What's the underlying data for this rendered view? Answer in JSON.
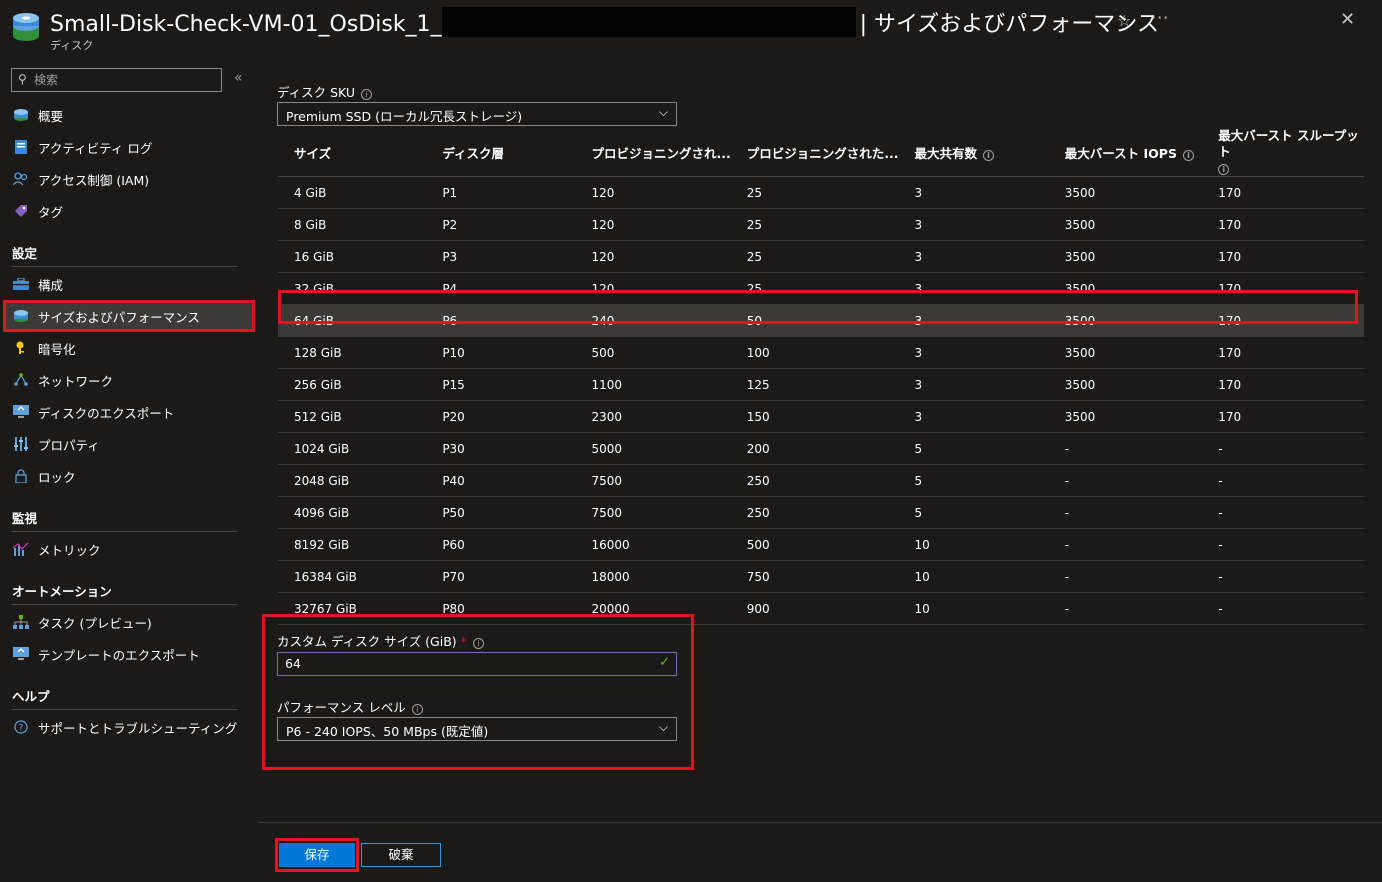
{
  "header": {
    "title_prefix": "Small-Disk-Check-VM-01_OsDisk_1_",
    "title_suffix": "| サイズおよびパフォーマンス",
    "subtitle": "ディスク",
    "star_glyph": "☆",
    "more_glyph": "···",
    "close_glyph": "✕"
  },
  "sidebar": {
    "search_placeholder": "検索",
    "collapse_glyph": "«",
    "items_top": [
      {
        "label": "概要",
        "icon": "disk-icon"
      },
      {
        "label": "アクティビティ ログ",
        "icon": "activity-log-icon"
      },
      {
        "label": "アクセス制御 (IAM)",
        "icon": "people-icon"
      },
      {
        "label": "タグ",
        "icon": "tag-icon"
      }
    ],
    "section_settings": "設定",
    "items_settings": [
      {
        "label": "構成",
        "icon": "toolbox-icon"
      },
      {
        "label": "サイズおよびパフォーマンス",
        "icon": "disk-icon"
      },
      {
        "label": "暗号化",
        "icon": "key-icon"
      },
      {
        "label": "ネットワーク",
        "icon": "network-icon"
      },
      {
        "label": "ディスクのエクスポート",
        "icon": "export-icon"
      },
      {
        "label": "プロパティ",
        "icon": "properties-icon"
      },
      {
        "label": "ロック",
        "icon": "lock-icon"
      }
    ],
    "section_monitoring": "監視",
    "items_monitoring": [
      {
        "label": "メトリック",
        "icon": "metrics-icon"
      }
    ],
    "section_automation": "オートメーション",
    "items_automation": [
      {
        "label": "タスク (プレビュー)",
        "icon": "tasks-icon"
      },
      {
        "label": "テンプレートのエクスポート",
        "icon": "template-export-icon"
      }
    ],
    "section_help": "ヘルプ",
    "items_help": [
      {
        "label": "サポートとトラブルシューティング",
        "icon": "help-icon"
      }
    ]
  },
  "main": {
    "sku_label": "ディスク SKU",
    "sku_value": "Premium SSD (ローカル冗長ストレージ)",
    "table": {
      "headers": [
        "サイズ",
        "ディスク層",
        "プロビジョニングされ...",
        "プロビジョニングされた...",
        "最大共有数",
        "最大バースト IOPS",
        "最大バースト スループット"
      ],
      "rows": [
        [
          "4 GiB",
          "P1",
          "120",
          "25",
          "3",
          "3500",
          "170"
        ],
        [
          "8 GiB",
          "P2",
          "120",
          "25",
          "3",
          "3500",
          "170"
        ],
        [
          "16 GiB",
          "P3",
          "120",
          "25",
          "3",
          "3500",
          "170"
        ],
        [
          "32 GiB",
          "P4",
          "120",
          "25",
          "3",
          "3500",
          "170"
        ],
        [
          "64 GiB",
          "P6",
          "240",
          "50",
          "3",
          "3500",
          "170"
        ],
        [
          "128 GiB",
          "P10",
          "500",
          "100",
          "3",
          "3500",
          "170"
        ],
        [
          "256 GiB",
          "P15",
          "1100",
          "125",
          "3",
          "3500",
          "170"
        ],
        [
          "512 GiB",
          "P20",
          "2300",
          "150",
          "3",
          "3500",
          "170"
        ],
        [
          "1024 GiB",
          "P30",
          "5000",
          "200",
          "5",
          "-",
          "-"
        ],
        [
          "2048 GiB",
          "P40",
          "7500",
          "250",
          "5",
          "-",
          "-"
        ],
        [
          "4096 GiB",
          "P50",
          "7500",
          "250",
          "5",
          "-",
          "-"
        ],
        [
          "8192 GiB",
          "P60",
          "16000",
          "500",
          "10",
          "-",
          "-"
        ],
        [
          "16384 GiB",
          "P70",
          "18000",
          "750",
          "10",
          "-",
          "-"
        ],
        [
          "32767 GiB",
          "P80",
          "20000",
          "900",
          "10",
          "-",
          "-"
        ]
      ],
      "selected_row": 4
    },
    "custom_size_label": "カスタム ディスク サイズ (GiB)",
    "custom_size_required": "*",
    "custom_size_value": "64",
    "perf_label": "パフォーマンス レベル",
    "perf_value": "P6 - 240 IOPS、50 MBps (既定値)",
    "save_label": "保存",
    "discard_label": "破棄"
  },
  "colors": {
    "background": "#1b1a19",
    "accent": "#0078d4",
    "highlight": "#e81123",
    "selected_row": "#3b3a39"
  }
}
